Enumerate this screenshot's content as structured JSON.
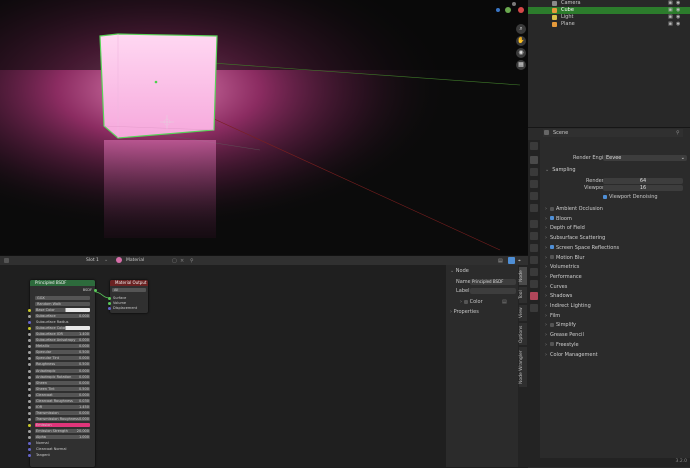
{
  "outliner": {
    "items": [
      {
        "label": "Camera",
        "selected": false
      },
      {
        "label": "Cube",
        "selected": true
      },
      {
        "label": "Light",
        "selected": false
      },
      {
        "label": "Plane",
        "selected": false
      }
    ]
  },
  "properties": {
    "scene_label": "Scene",
    "render_engine_label": "Render Engine",
    "render_engine_value": "Eevee",
    "sampling_label": "Sampling",
    "render_label": "Render",
    "render_value": "64",
    "viewport_label": "Viewport",
    "viewport_value": "16",
    "viewport_denoising_label": "Viewport Denoising",
    "sections": [
      {
        "label": "Ambient Occlusion",
        "checkbox": true,
        "checked": false
      },
      {
        "label": "Bloom",
        "checkbox": true,
        "checked": true
      },
      {
        "label": "Depth of Field",
        "checkbox": false,
        "checked": false
      },
      {
        "label": "Subsurface Scattering",
        "checkbox": false,
        "checked": false
      },
      {
        "label": "Screen Space Reflections",
        "checkbox": true,
        "checked": true
      },
      {
        "label": "Motion Blur",
        "checkbox": true,
        "checked": false
      },
      {
        "label": "Volumetrics",
        "checkbox": false,
        "checked": false
      },
      {
        "label": "Performance",
        "checkbox": false,
        "checked": false
      },
      {
        "label": "Curves",
        "checkbox": false,
        "checked": false
      },
      {
        "label": "Shadows",
        "checkbox": false,
        "checked": false
      },
      {
        "label": "Indirect Lighting",
        "checkbox": false,
        "checked": false
      },
      {
        "label": "Film",
        "checkbox": false,
        "checked": false
      },
      {
        "label": "Simplify",
        "checkbox": true,
        "checked": false
      },
      {
        "label": "Grease Pencil",
        "checkbox": false,
        "checked": false
      },
      {
        "label": "Freestyle",
        "checkbox": true,
        "checked": false
      },
      {
        "label": "Color Management",
        "checkbox": false,
        "checked": false
      }
    ]
  },
  "node_header": {
    "slot": "Slot 1",
    "material": "Material"
  },
  "node_sidebar": {
    "title": "Node",
    "name_label": "Name",
    "name_value": "Principled BSDF",
    "label_label": "Label",
    "color_label": "Color",
    "properties_label": "Properties"
  },
  "node_tabs": [
    "Node",
    "Tool",
    "View",
    "Options",
    "Node Wrangler"
  ],
  "bsdf_node": {
    "title": "Principled BSDF",
    "output": "BSDF",
    "distribution": "GGX",
    "subsurface_method": "Random Walk",
    "rows": [
      {
        "label": "Base Color",
        "value": ""
      },
      {
        "label": "Subsurface",
        "value": "0.000"
      },
      {
        "label": "Subsurface Radius",
        "value": ""
      },
      {
        "label": "Subsurface Color",
        "value": ""
      },
      {
        "label": "Subsurface IOR",
        "value": "1.400"
      },
      {
        "label": "Subsurface Anisotropy",
        "value": "0.000"
      },
      {
        "label": "Metallic",
        "value": "0.000"
      },
      {
        "label": "Specular",
        "value": "0.500"
      },
      {
        "label": "Specular Tint",
        "value": "0.000"
      },
      {
        "label": "Roughness",
        "value": "0.500"
      },
      {
        "label": "Anisotropic",
        "value": "0.000"
      },
      {
        "label": "Anisotropic Rotation",
        "value": "0.000"
      },
      {
        "label": "Sheen",
        "value": "0.000"
      },
      {
        "label": "Sheen Tint",
        "value": "0.500"
      },
      {
        "label": "Clearcoat",
        "value": "0.000"
      },
      {
        "label": "Clearcoat Roughness",
        "value": "0.030"
      },
      {
        "label": "IOR",
        "value": "1.450"
      },
      {
        "label": "Transmission",
        "value": "0.000"
      },
      {
        "label": "Transmission Roughness",
        "value": "0.000"
      },
      {
        "label": "Emission",
        "value": ""
      },
      {
        "label": "Emission Strength",
        "value": "20.000"
      },
      {
        "label": "Alpha",
        "value": "1.000"
      },
      {
        "label": "Normal",
        "value": ""
      },
      {
        "label": "Clearcoat Normal",
        "value": ""
      },
      {
        "label": "Tangent",
        "value": ""
      }
    ]
  },
  "output_node": {
    "title": "Material Output",
    "target": "All",
    "sockets": [
      "Surface",
      "Volume",
      "Displacement"
    ]
  },
  "version": "3.2.0",
  "colors": {
    "emission": "#e0357a",
    "selected_row": "#2c7c2c",
    "accent": "#4f8fd6"
  }
}
